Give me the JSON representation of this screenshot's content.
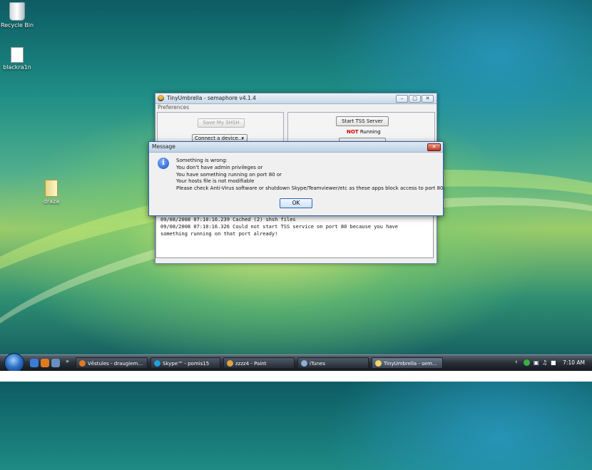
{
  "desktop": {
    "icons": [
      {
        "label": "Recycle Bin"
      },
      {
        "label": "blackra1n"
      },
      {
        "label": "draza"
      }
    ]
  },
  "app": {
    "title": "TinyUmbrella - semaphore v4.1.4",
    "menu": "Preferences",
    "save_shsh": "Save My SHSH",
    "connect": "Connect a device...",
    "start_tss": "Start TSS Server",
    "status_not": "NOT",
    "status_running": "Running",
    "log": [
      "09/08/2008 07:10:16.239 Cached (2) shsh files",
      "09/08/2008 07:10:16.326 Could not start TSS service on port 80 because you have",
      "something running on that port already!"
    ]
  },
  "message": {
    "title": "Message",
    "lines": [
      "Something is wrong:",
      "You don't have admin privileges or",
      "You have something running on port 80 or",
      "Your hosts file is not modifiable",
      "Please check Anti-Virus software or shutdown Skype/Teamviewer/etc as these apps block access to port 80."
    ],
    "ok": "OK"
  },
  "taskbar": {
    "tasks": [
      {
        "label": "Vēstules - draugiem..."
      },
      {
        "label": "Skype™ - pomis15"
      },
      {
        "label": "zzzz4 - Paint"
      },
      {
        "label": "iTunes"
      },
      {
        "label": "TinyUmbrella - sem..."
      }
    ],
    "clock": "7:10 AM"
  },
  "colors": {
    "status_not": "#cc0000",
    "taskbar": "#1c2229"
  }
}
